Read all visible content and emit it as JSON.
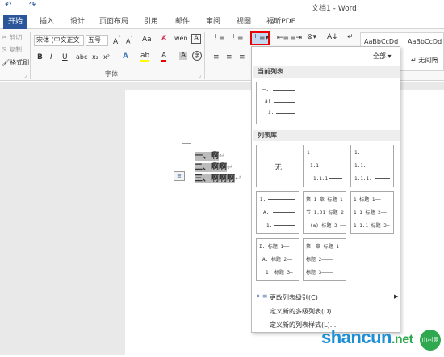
{
  "window": {
    "title": "文档1 - Word"
  },
  "tabs": [
    {
      "label": "开始",
      "active": true
    },
    {
      "label": "插入"
    },
    {
      "label": "设计"
    },
    {
      "label": "页面布局"
    },
    {
      "label": "引用"
    },
    {
      "label": "邮件"
    },
    {
      "label": "审阅"
    },
    {
      "label": "视图"
    },
    {
      "label": "福昕PDF"
    }
  ],
  "clipboard": {
    "cut": "剪切",
    "copy": "复制",
    "format_painter": "格式刷"
  },
  "font": {
    "name": "宋体 (中文正文",
    "size": "五号",
    "group_label": "字体"
  },
  "styles": {
    "style1": "AaBbCcDd",
    "style2": "AaBbCcDd",
    "no_spacing": "无间隔"
  },
  "document": {
    "lines": [
      "一、啊",
      "二、啊啊",
      "三、啊啊啊"
    ]
  },
  "menu": {
    "filter": "全部",
    "current_list_header": "当前列表",
    "library_header": "列表库",
    "none_label": "无",
    "items": [
      "更改列表级别(C)",
      "定义新的多级列表(D)...",
      "定义新的列表样式(L)..."
    ]
  },
  "watermark": {
    "text": "shancun",
    "suffix": ".net",
    "cn": "山村网"
  }
}
